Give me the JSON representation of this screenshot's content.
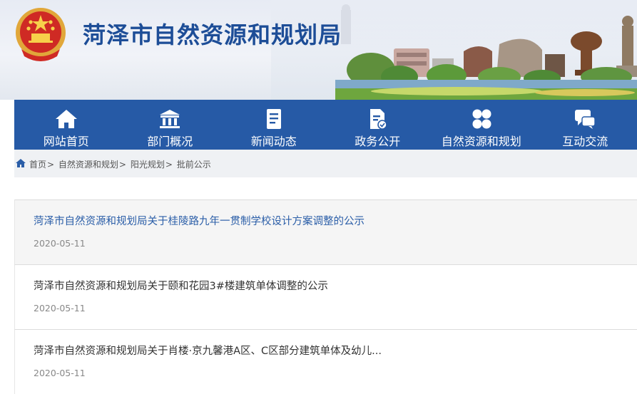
{
  "site": {
    "title": "菏泽市自然资源和规划局"
  },
  "nav": {
    "items": [
      {
        "label": "网站首页",
        "icon": "home-icon"
      },
      {
        "label": "部门概况",
        "icon": "building-icon"
      },
      {
        "label": "新闻动态",
        "icon": "document-icon"
      },
      {
        "label": "政务公开",
        "icon": "file-check-icon"
      },
      {
        "label": "自然资源和规划",
        "icon": "grid-icon"
      },
      {
        "label": "互动交流",
        "icon": "chat-icon"
      }
    ]
  },
  "breadcrumb": {
    "icon": "home-icon",
    "items": [
      "首页",
      "自然资源和规划",
      "阳光规划",
      "批前公示"
    ],
    "separator": ">"
  },
  "list": [
    {
      "title": "菏泽市自然资源和规划局关于桂陵路九年一贯制学校设计方案调整的公示",
      "date": "2020-05-11"
    },
    {
      "title": "菏泽市自然资源和规划局关于颐和花园3#楼建筑单体调整的公示",
      "date": "2020-05-11"
    },
    {
      "title": "菏泽市自然资源和规划局关于肖楼·京九馨港A区、C区部分建筑单体及幼儿...",
      "date": "2020-05-11"
    }
  ],
  "colors": {
    "nav_bg": "#265aa6",
    "title": "#1d4d97",
    "link_active": "#2b5ea8"
  }
}
